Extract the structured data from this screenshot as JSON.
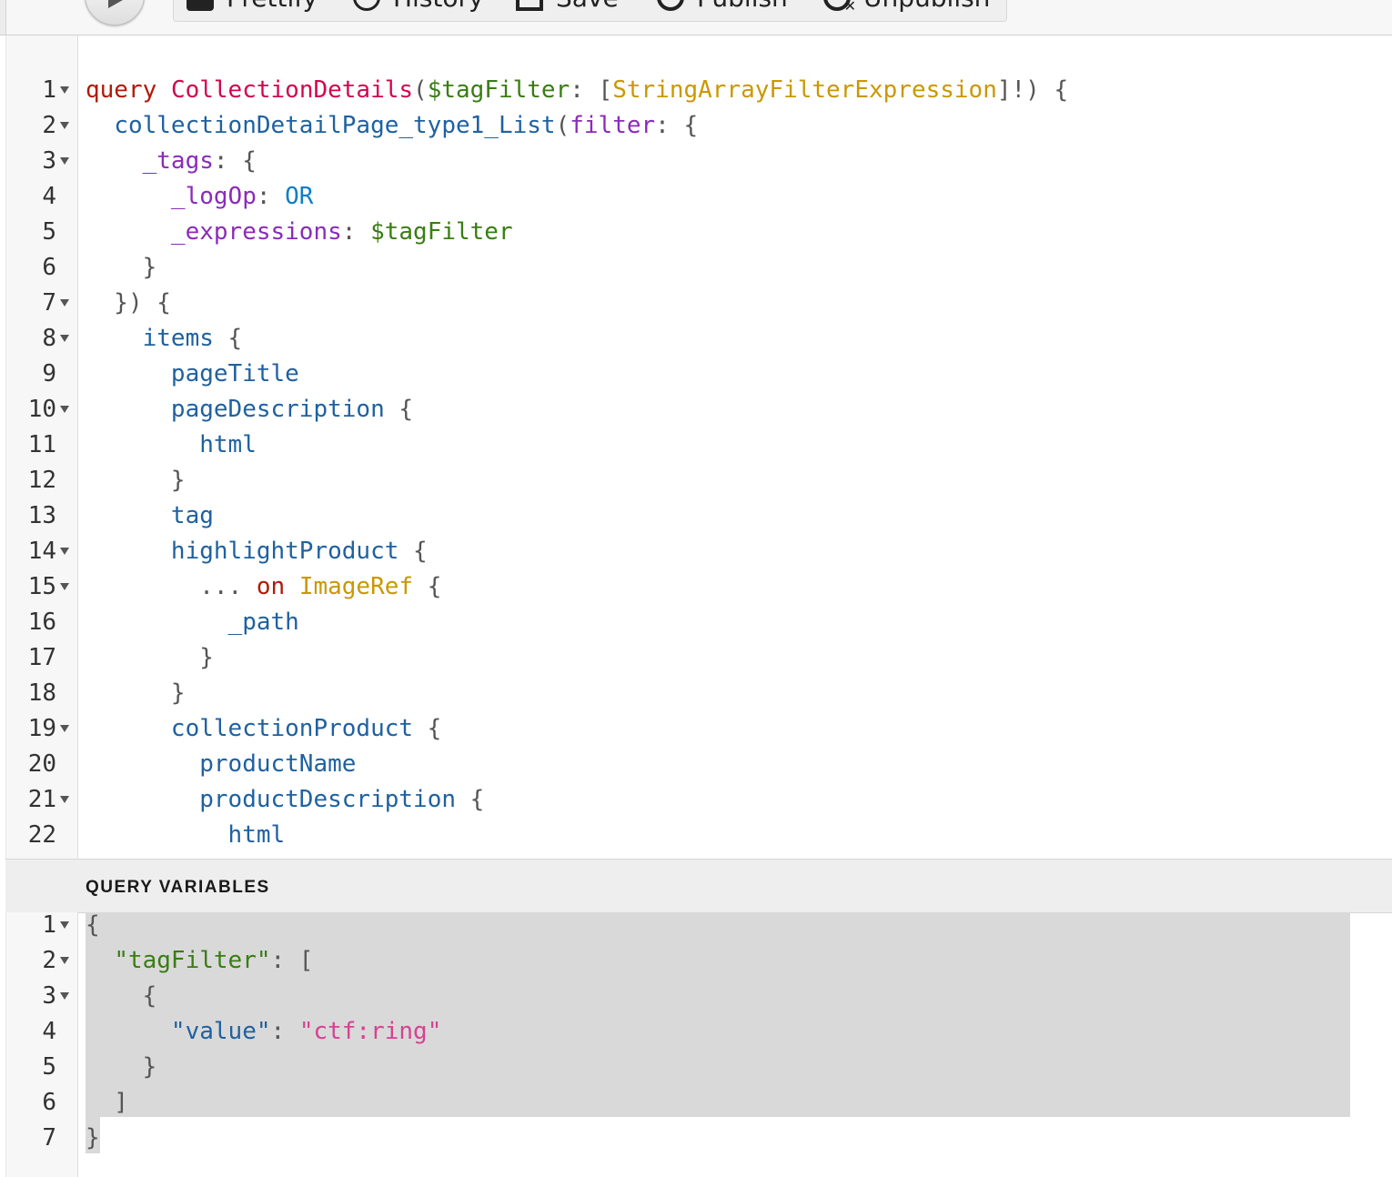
{
  "toolbar": {
    "run_icon": "play-icon",
    "buttons": [
      {
        "label": "Prettify",
        "icon": "prettify-icon"
      },
      {
        "label": "History",
        "icon": "history-icon"
      },
      {
        "label": "Save",
        "icon": "save-icon"
      },
      {
        "label": "Publish",
        "icon": "publish-icon"
      },
      {
        "label": "Unpublish",
        "icon": "unpublish-icon"
      }
    ]
  },
  "query_editor": {
    "lines": [
      {
        "n": "1",
        "fold": true,
        "tokens": [
          [
            "kw",
            "query"
          ],
          [
            "punc",
            " "
          ],
          [
            "def",
            "CollectionDetails"
          ],
          [
            "punc",
            "("
          ],
          [
            "var",
            "$tagFilter"
          ],
          [
            "punc",
            ": ["
          ],
          [
            "type",
            "StringArrayFilterExpression"
          ],
          [
            "punc",
            "]!) {"
          ]
        ]
      },
      {
        "n": "2",
        "fold": true,
        "tokens": [
          [
            "punc",
            "  "
          ],
          [
            "prop",
            "collectionDetailPage_type1_List"
          ],
          [
            "punc",
            "("
          ],
          [
            "attr",
            "filter"
          ],
          [
            "punc",
            ": {"
          ]
        ]
      },
      {
        "n": "3",
        "fold": true,
        "tokens": [
          [
            "punc",
            "    "
          ],
          [
            "attr",
            "_tags"
          ],
          [
            "punc",
            ": {"
          ]
        ]
      },
      {
        "n": "4",
        "fold": false,
        "tokens": [
          [
            "punc",
            "      "
          ],
          [
            "attr",
            "_logOp"
          ],
          [
            "punc",
            ": "
          ],
          [
            "enum",
            "OR"
          ]
        ]
      },
      {
        "n": "5",
        "fold": false,
        "tokens": [
          [
            "punc",
            "      "
          ],
          [
            "attr",
            "_expressions"
          ],
          [
            "punc",
            ": "
          ],
          [
            "var",
            "$tagFilter"
          ]
        ]
      },
      {
        "n": "6",
        "fold": false,
        "tokens": [
          [
            "punc",
            "    }"
          ]
        ]
      },
      {
        "n": "7",
        "fold": true,
        "tokens": [
          [
            "punc",
            "  }) {"
          ]
        ]
      },
      {
        "n": "8",
        "fold": true,
        "tokens": [
          [
            "punc",
            "    "
          ],
          [
            "prop",
            "items"
          ],
          [
            "punc",
            " {"
          ]
        ]
      },
      {
        "n": "9",
        "fold": false,
        "tokens": [
          [
            "punc",
            "      "
          ],
          [
            "prop",
            "pageTitle"
          ]
        ]
      },
      {
        "n": "10",
        "fold": true,
        "tokens": [
          [
            "punc",
            "      "
          ],
          [
            "prop",
            "pageDescription"
          ],
          [
            "punc",
            " {"
          ]
        ]
      },
      {
        "n": "11",
        "fold": false,
        "tokens": [
          [
            "punc",
            "        "
          ],
          [
            "prop",
            "html"
          ]
        ]
      },
      {
        "n": "12",
        "fold": false,
        "tokens": [
          [
            "punc",
            "      }"
          ]
        ]
      },
      {
        "n": "13",
        "fold": false,
        "tokens": [
          [
            "punc",
            "      "
          ],
          [
            "prop",
            "tag"
          ]
        ]
      },
      {
        "n": "14",
        "fold": true,
        "tokens": [
          [
            "punc",
            "      "
          ],
          [
            "prop",
            "highlightProduct"
          ],
          [
            "punc",
            " {"
          ]
        ]
      },
      {
        "n": "15",
        "fold": true,
        "tokens": [
          [
            "punc",
            "        ... "
          ],
          [
            "kw",
            "on"
          ],
          [
            "punc",
            " "
          ],
          [
            "type",
            "ImageRef"
          ],
          [
            "punc",
            " {"
          ]
        ]
      },
      {
        "n": "16",
        "fold": false,
        "tokens": [
          [
            "punc",
            "          "
          ],
          [
            "prop",
            "_path"
          ]
        ]
      },
      {
        "n": "17",
        "fold": false,
        "tokens": [
          [
            "punc",
            "        }"
          ]
        ]
      },
      {
        "n": "18",
        "fold": false,
        "tokens": [
          [
            "punc",
            "      }"
          ]
        ]
      },
      {
        "n": "19",
        "fold": true,
        "tokens": [
          [
            "punc",
            "      "
          ],
          [
            "prop",
            "collectionProduct"
          ],
          [
            "punc",
            " {"
          ]
        ]
      },
      {
        "n": "20",
        "fold": false,
        "tokens": [
          [
            "punc",
            "        "
          ],
          [
            "prop",
            "productName"
          ]
        ]
      },
      {
        "n": "21",
        "fold": true,
        "tokens": [
          [
            "punc",
            "        "
          ],
          [
            "prop",
            "productDescription"
          ],
          [
            "punc",
            " {"
          ]
        ]
      },
      {
        "n": "22",
        "fold": false,
        "tokens": [
          [
            "punc",
            "          "
          ],
          [
            "prop",
            "html"
          ]
        ]
      }
    ]
  },
  "variables_pane": {
    "title": "QUERY VARIABLES",
    "lines": [
      {
        "n": "1",
        "fold": true,
        "tokens": [
          [
            "punc",
            "{"
          ]
        ]
      },
      {
        "n": "2",
        "fold": true,
        "tokens": [
          [
            "punc",
            "  "
          ],
          [
            "jkey",
            "\"tagFilter\""
          ],
          [
            "punc",
            ": ["
          ]
        ]
      },
      {
        "n": "3",
        "fold": true,
        "tokens": [
          [
            "punc",
            "    {"
          ]
        ]
      },
      {
        "n": "4",
        "fold": false,
        "tokens": [
          [
            "punc",
            "      "
          ],
          [
            "prop",
            "\"value\""
          ],
          [
            "punc",
            ": "
          ],
          [
            "str",
            "\"ctf:ring\""
          ]
        ]
      },
      {
        "n": "5",
        "fold": false,
        "tokens": [
          [
            "punc",
            "    }"
          ]
        ]
      },
      {
        "n": "6",
        "fold": false,
        "tokens": [
          [
            "punc",
            "  ]"
          ]
        ]
      },
      {
        "n": "7",
        "fold": false,
        "tokens": [
          [
            "punc",
            "}"
          ]
        ]
      }
    ]
  },
  "colors": {
    "keyword": "#b11a04",
    "definition": "#d2054e",
    "variable": "#397d13",
    "type": "#ca9800",
    "property": "#1f61a0",
    "attribute": "#8b2bb9",
    "enum": "#0b7fc7",
    "string": "#d64292",
    "selection": "#d9d9d9"
  }
}
